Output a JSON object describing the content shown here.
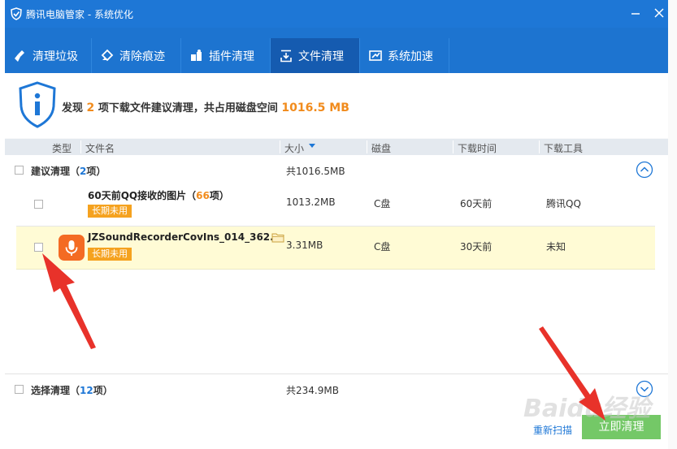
{
  "window": {
    "title": "腾讯电脑管家 - 系统优化",
    "icon": "shield-logo-icon"
  },
  "tabs": [
    {
      "label": "清理垃圾",
      "icon": "broom-icon"
    },
    {
      "label": "清除痕迹",
      "icon": "eraser-icon"
    },
    {
      "label": "插件清理",
      "icon": "puzzle-icon"
    },
    {
      "label": "文件清理",
      "icon": "download-box-icon",
      "active": true
    },
    {
      "label": "系统加速",
      "icon": "speedup-icon"
    }
  ],
  "summary": {
    "prefix": "发现",
    "count": "2",
    "middle": "项下载文件建议清理，共占用磁盘空间",
    "size": "1016.5 MB"
  },
  "table": {
    "columns": [
      "类型",
      "文件名",
      "大小",
      "磁盘",
      "下载时间",
      "下载工具"
    ]
  },
  "groups": [
    {
      "title": "建议清理",
      "count_open": "（",
      "count": "2",
      "count_close": "项）",
      "size": "共1016.5MB",
      "rows": [
        {
          "name": "60天前QQ接收的图片",
          "count_open": "（",
          "count": "66",
          "count_close": "项）",
          "badge": "长期未用",
          "size": "1013.2MB",
          "disk": "C盘",
          "time": "60天前",
          "tool": "腾讯QQ"
        },
        {
          "name": "JZSoundRecorderCovIns_014_362...",
          "badge": "长期未用",
          "size": "3.31MB",
          "disk": "C盘",
          "time": "30天前",
          "tool": "未知",
          "icon": "microphone-icon"
        }
      ]
    },
    {
      "title": "选择清理",
      "count_open": "（",
      "count": "12",
      "count_close": "项）",
      "size": "共234.9MB"
    }
  ],
  "actions": {
    "rescan": "重新扫描",
    "clean": "立即清理"
  },
  "watermark": "Baidu经验",
  "colors": {
    "titlebar": "#1e77d6",
    "tab_active": "#155bb0",
    "accent_orange": "#f18b1c",
    "badge": "#f5a21f",
    "clean_button": "#74c867",
    "arrow": "#e8322a"
  }
}
